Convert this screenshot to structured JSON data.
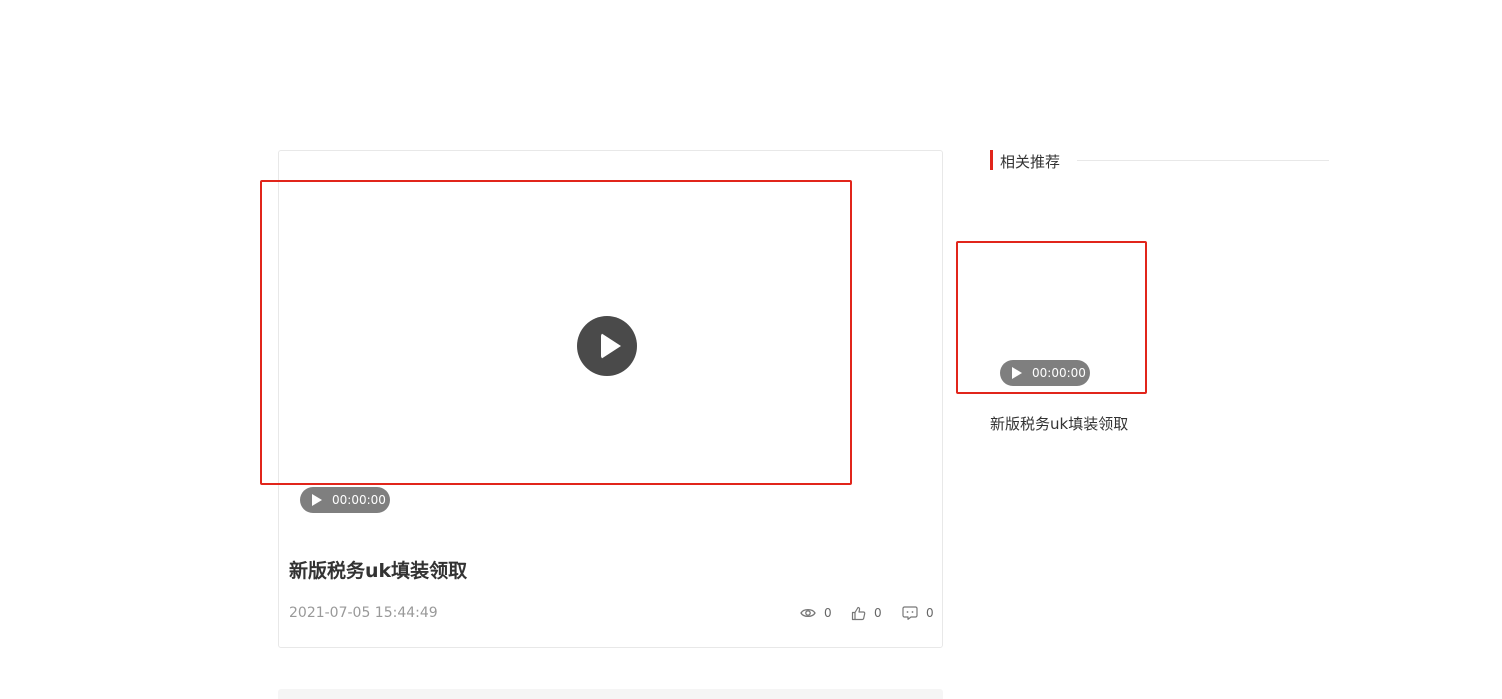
{
  "main": {
    "duration": "00:00:00",
    "title": "新版税务uk填装领取",
    "date": "2021-07-05 15:44:49",
    "stats": {
      "views": "0",
      "likes": "0",
      "comments": "0"
    }
  },
  "sidebar": {
    "heading": "相关推荐",
    "items": [
      {
        "duration": "00:00:00",
        "title": "新版税务uk填装领取"
      }
    ]
  },
  "icons": {
    "play": "play-icon",
    "views": "eye-icon",
    "likes": "thumbs-up-icon",
    "comments": "comment-icon"
  },
  "colors": {
    "accent": "#e1251b",
    "pill": "#7f7f7f",
    "play_button": "#4a4a4a"
  }
}
